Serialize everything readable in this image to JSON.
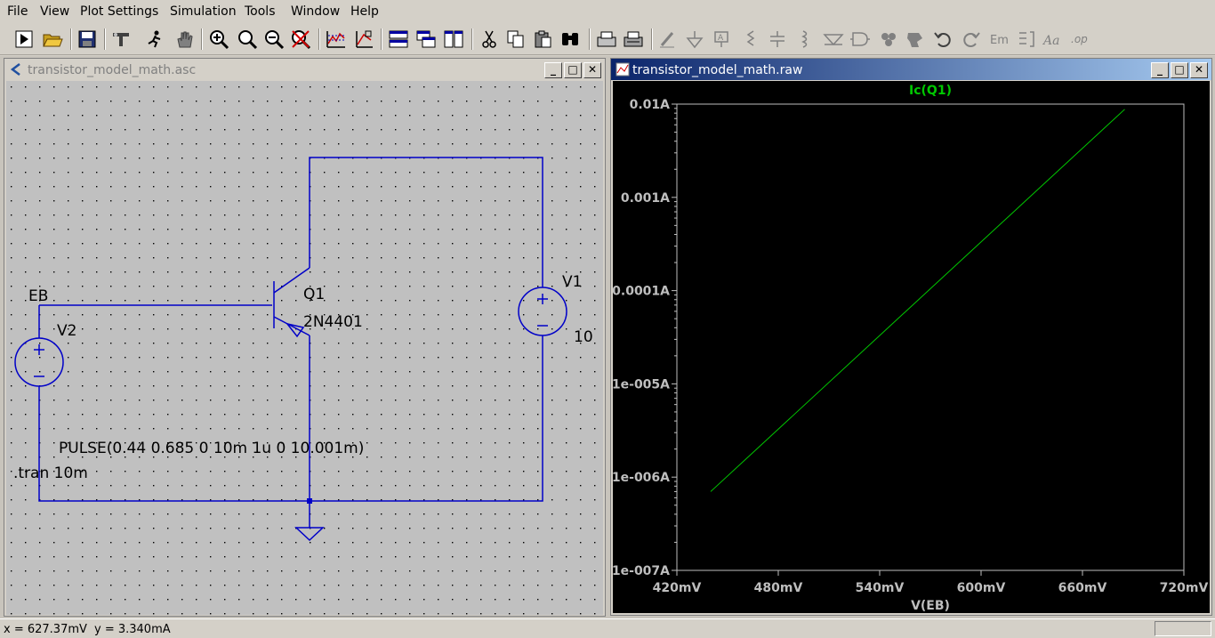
{
  "menu": {
    "file": "File",
    "view": "View",
    "plot_settings": "Plot Settings",
    "simulation": "Simulation",
    "tools": "Tools",
    "window": "Window",
    "help": "Help"
  },
  "schematic_window": {
    "title": "transistor_model_math.asc",
    "labels": {
      "eb": "EB",
      "v2": "V2",
      "q1": "Q1",
      "q1_model": "2N4401",
      "v1": "V1",
      "v1_value": "10",
      "pulse": "PULSE(0.44 0.685 0 10m 1u 0 10.001m)",
      "tran": ".tran 10m"
    }
  },
  "plot_window": {
    "title": "transistor_model_math.raw"
  },
  "chart_data": {
    "type": "line",
    "title": "Ic(Q1)",
    "xlabel": "V(EB)",
    "ylabel": "",
    "x_ticks": [
      "420mV",
      "480mV",
      "540mV",
      "600mV",
      "660mV",
      "720mV"
    ],
    "y_ticks": [
      "0.01A",
      "0.001A",
      "0.0001A",
      "1e-005A",
      "1e-006A",
      "1e-007A"
    ],
    "xlim": [
      0.42,
      0.72
    ],
    "ylim": [
      1e-07,
      0.01
    ],
    "yscale": "log",
    "grid": false,
    "series": [
      {
        "name": "Ic(Q1)",
        "color": "#00c800",
        "x": [
          0.44,
          0.685
        ],
        "y": [
          7e-07,
          0.0088
        ]
      }
    ]
  },
  "status": {
    "x": "x = 627.37mV",
    "y": "y = 3.340mA"
  },
  "icons": [
    "run-icon",
    "open-icon",
    "save-icon",
    "control-panel-icon",
    "halt-icon",
    "pan-icon",
    "zoom-in-icon",
    "zoom-back-icon",
    "zoom-out-icon",
    "zoom-cancel-icon",
    "autorange-icon",
    "manual-limits-icon",
    "tile-horizontal-icon",
    "cascade-icon",
    "tile-vertical-icon",
    "cut-icon",
    "copy-icon",
    "paste-icon",
    "find-icon",
    "print-preview-icon",
    "print-icon",
    "wire-icon",
    "ground-icon",
    "label-net-icon",
    "resistor-icon",
    "capacitor-icon",
    "inductor-icon",
    "diode-icon",
    "component-icon",
    "rotate-icon",
    "mirror-icon",
    "undo-icon",
    "redo-icon",
    "text-icon",
    "spice-directive-icon"
  ],
  "colors": {
    "wire": "#0000c8",
    "trace": "#00c800",
    "plot_bg": "#000000",
    "axis_text": "#bebebe"
  }
}
